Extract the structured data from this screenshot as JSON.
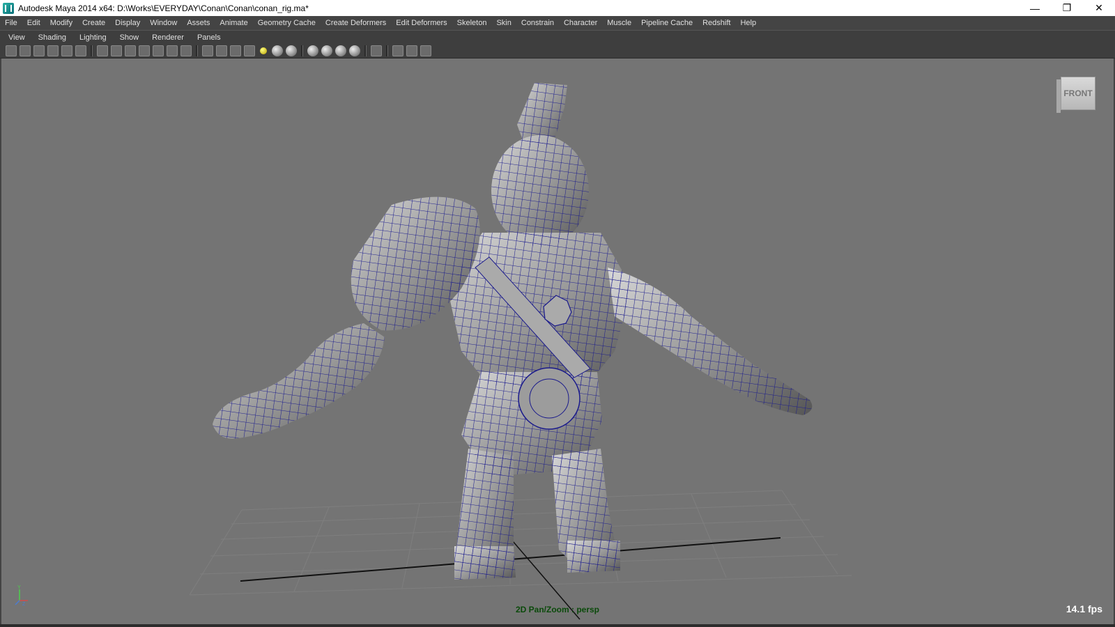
{
  "window": {
    "title": "Autodesk Maya 2014 x64: D:\\Works\\EVERYDAY\\Conan\\Conan\\conan_rig.ma*",
    "controls": {
      "minimize": "—",
      "restore": "❐",
      "close": "✕"
    }
  },
  "menubar": {
    "items": [
      "File",
      "Edit",
      "Modify",
      "Create",
      "Display",
      "Window",
      "Assets",
      "Animate",
      "Geometry Cache",
      "Create Deformers",
      "Edit Deformers",
      "Skeleton",
      "Skin",
      "Constrain",
      "Character",
      "Muscle",
      "Pipeline Cache",
      "Redshift",
      "Help"
    ]
  },
  "panel_menu": {
    "items": [
      "View",
      "Shading",
      "Lighting",
      "Show",
      "Renderer",
      "Panels"
    ]
  },
  "viewport": {
    "viewcube_label": "FRONT",
    "hud_label": "2D Pan/Zoom : persp",
    "fps": "14.1 fps",
    "axis_labels": {
      "y": "Y",
      "z": "Z"
    },
    "colors": {
      "background": "#747474",
      "wireframe": "#1a1a8c",
      "mesh": "#9a9a9a"
    }
  }
}
